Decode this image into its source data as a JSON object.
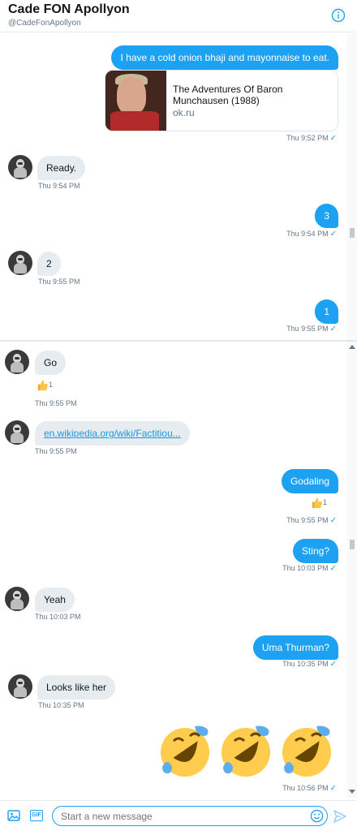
{
  "header": {
    "name": "Cade FON Apollyon",
    "handle": "@CadeFonApollyon"
  },
  "pane1": {
    "out1": {
      "text": "I have a cold onion bhaji and mayonnaise to eat."
    },
    "card": {
      "title": "The Adventures Of Baron Munchausen (1988)",
      "domain": "ok.ru",
      "time": "Thu 9:52 PM"
    },
    "in1": {
      "text": "Ready.",
      "time": "Thu 9:54 PM"
    },
    "out2": {
      "text": "3",
      "time": "Thu 9:54 PM"
    },
    "in2": {
      "text": "2",
      "time": "Thu 9:55 PM"
    },
    "out3": {
      "text": "1",
      "time": "Thu 9:55 PM"
    }
  },
  "pane2": {
    "in_go": {
      "text": "Go",
      "reaction_count": "1",
      "time": "Thu 9:55 PM"
    },
    "in_link": {
      "text": "en.wikipedia.org/wiki/Factitiou...",
      "time": "Thu 9:55 PM"
    },
    "out_godaling": {
      "text": "Godaling",
      "reaction_count": "1",
      "time": "Thu 9:55 PM"
    },
    "out_sting": {
      "text": "Sting?",
      "time": "Thu 10:03 PM"
    },
    "in_yeah": {
      "text": "Yeah",
      "time": "Thu 10:03 PM"
    },
    "out_uma": {
      "text": "Uma Thurman?",
      "time": "Thu 10:35 PM"
    },
    "in_looks": {
      "text": "Looks like her",
      "time": "Thu 10:35 PM"
    },
    "out_emoji": {
      "time": "Thu 10:56 PM",
      "emoji_name": "rolling-on-the-floor-laughing",
      "count": 3
    }
  },
  "composer": {
    "placeholder": "Start a new message"
  },
  "colors": {
    "accent": "#1da1f2",
    "bubble_in": "#e6ecf0",
    "text_muted": "#657786"
  }
}
